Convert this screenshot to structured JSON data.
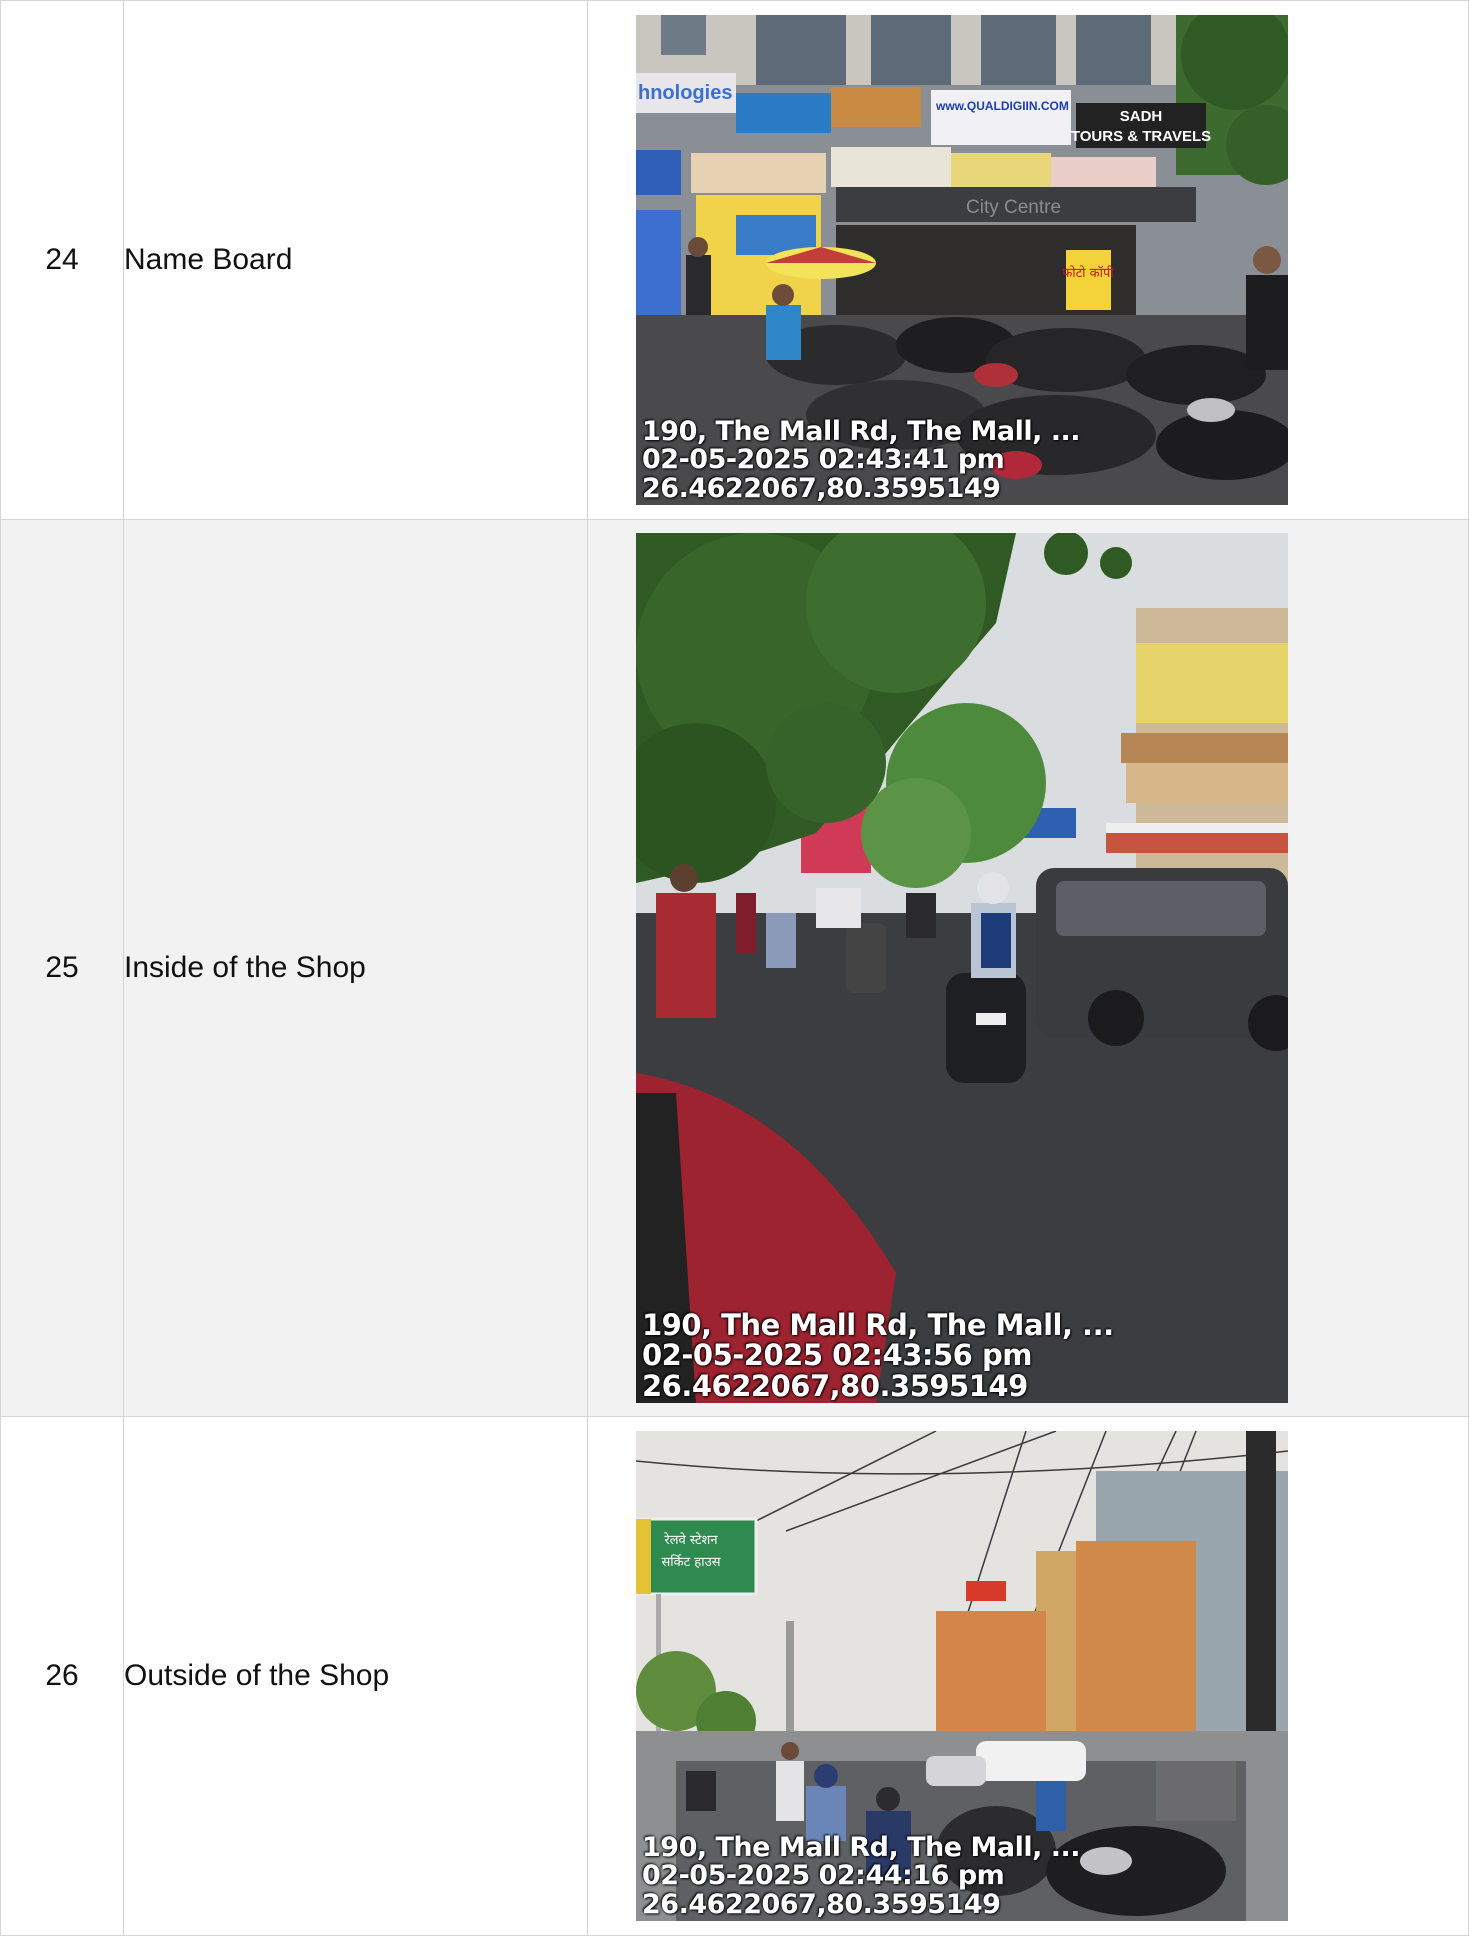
{
  "rows": [
    {
      "number": "24",
      "label": "Name Board",
      "photo": {
        "scene": "storefront-signboards-with-parked-motorcycles",
        "address": "190, The Mall Rd, The Mall, ...",
        "datetime": "02-05-2025  02:43:41  pm",
        "coords": "26.4622067,80.3595149",
        "signs": [
          "hnologies",
          "www.QUALDIGIIN.COM",
          "SADH",
          "TOURS & TRAVELS",
          "City Centre",
          "फोटो कॉपी"
        ]
      }
    },
    {
      "number": "25",
      "label": "Inside of the Shop",
      "photo": {
        "scene": "busy-street-with-scooters-and-car",
        "address": "190, The Mall Rd, The Mall, ...",
        "datetime": "02-05-2025  02:43:56  pm",
        "coords": "26.4622067,80.3595149"
      }
    },
    {
      "number": "26",
      "label": "Outside of the Shop",
      "photo": {
        "scene": "wide-road-with-buildings-and-overhead-wires",
        "address": "190, The Mall Rd, The Mall, ...",
        "datetime": "02-05-2025  02:44:16  pm",
        "coords": "26.4622067,80.3595149",
        "signs": [
          "रेलवे स्टेशन",
          "सर्किट हाउस"
        ]
      }
    }
  ]
}
